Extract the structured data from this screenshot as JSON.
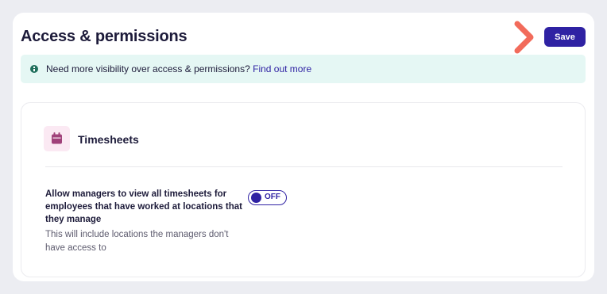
{
  "header": {
    "title": "Access & permissions",
    "save_label": "Save",
    "arrow_color": "#f26b5b"
  },
  "banner": {
    "text": "Need more visibility over access & permissions?",
    "link": "Find out more",
    "icon": "info-icon"
  },
  "section": {
    "title": "Timesheets",
    "icon": "calendar-icon",
    "setting": {
      "label": "Allow managers to view all timesheets for employees that have worked at locations that they manage",
      "description": "This will include locations the managers don't have access to",
      "toggle_state": "OFF"
    }
  },
  "colors": {
    "primary": "#2f22a3",
    "banner_bg": "#e5f7f4",
    "icon_bg": "#fbe9f3",
    "icon_fg": "#a0417a"
  }
}
